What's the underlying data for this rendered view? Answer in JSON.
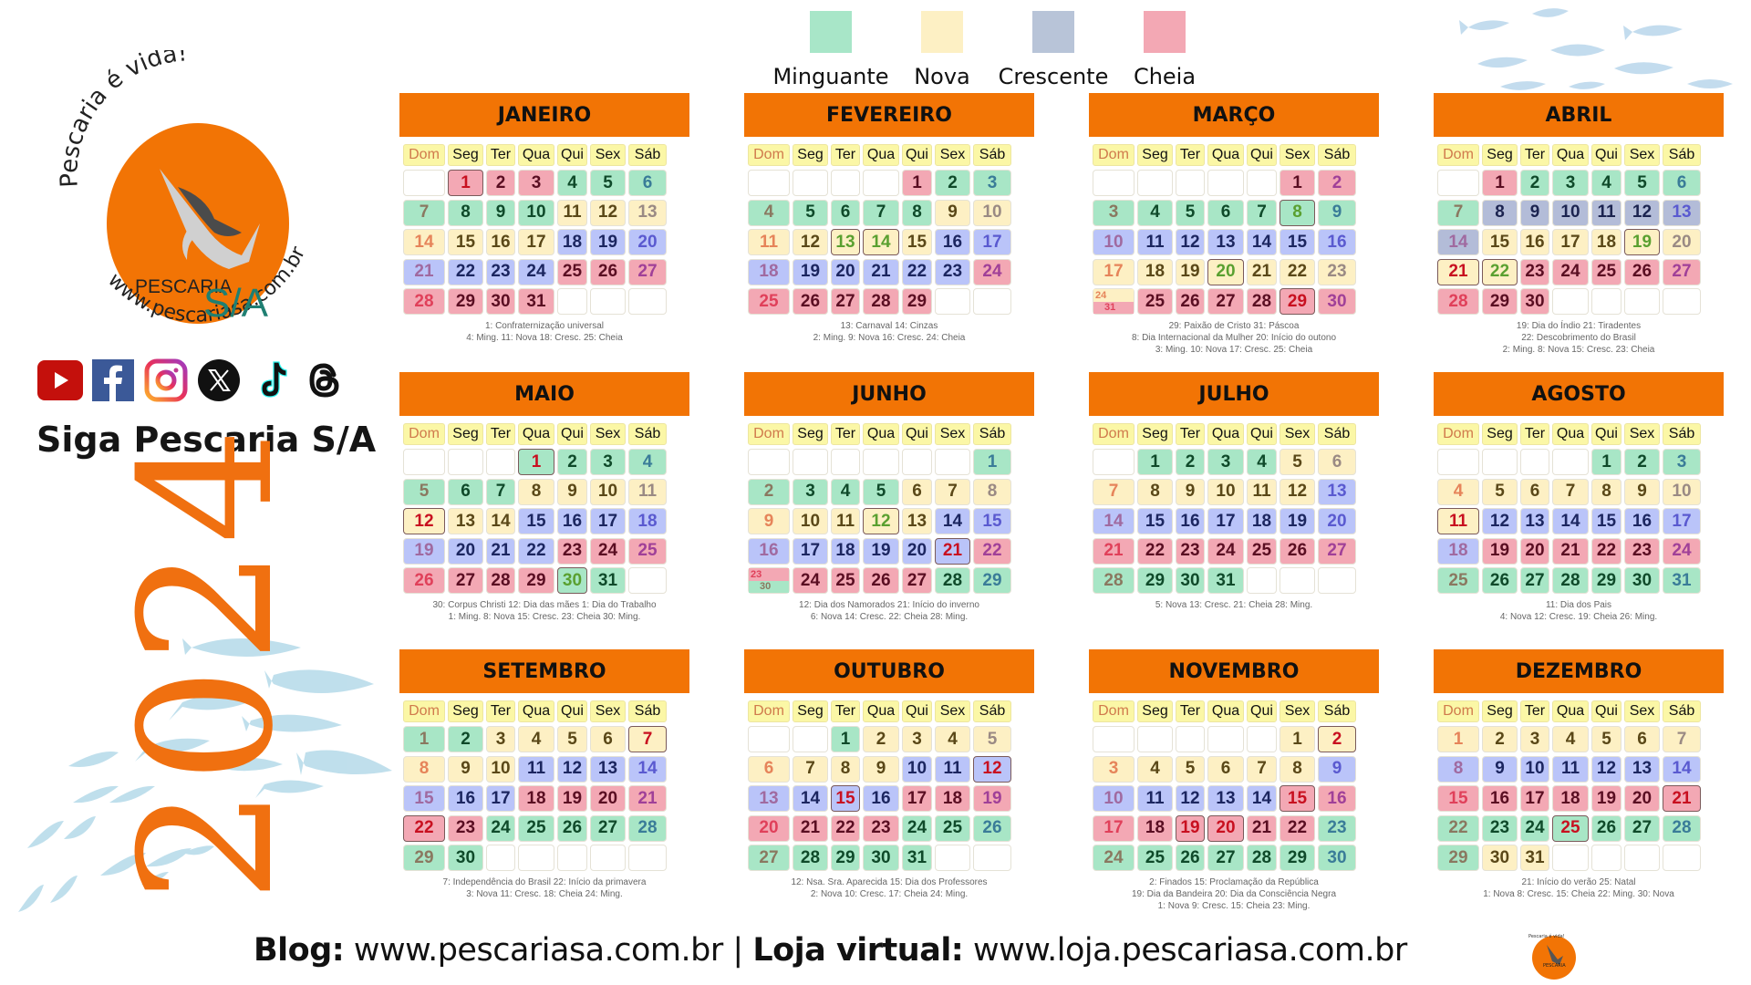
{
  "brand": {
    "tagline": "Pescaria é vida!",
    "name_main": "PESCARIA",
    "name_suffix": "S/A",
    "site": "www.pescariasa.com.br",
    "accent": "#f27405",
    "follow": "Siga Pescaria S/A",
    "year": "2024"
  },
  "socials": [
    {
      "name": "youtube",
      "icon": "youtube-icon"
    },
    {
      "name": "facebook",
      "icon": "facebook-icon"
    },
    {
      "name": "instagram",
      "icon": "instagram-icon"
    },
    {
      "name": "x",
      "icon": "x-icon"
    },
    {
      "name": "tiktok",
      "icon": "tiktok-icon"
    },
    {
      "name": "threads",
      "icon": "threads-icon"
    }
  ],
  "legend": [
    {
      "label": "Minguante",
      "color": "#a8e6c6"
    },
    {
      "label": "Nova",
      "color": "#fdf0c4"
    },
    {
      "label": "Crescente",
      "color": "#b8c4d8"
    },
    {
      "label": "Cheia",
      "color": "#f3a8b4"
    }
  ],
  "weekdays": [
    "Dom",
    "Seg",
    "Ter",
    "Qua",
    "Qui",
    "Sex",
    "Sáb"
  ],
  "months": [
    {
      "name": "JANEIRO",
      "cells": "w,p1h,p2,p3,g4,g5,g6|g7,g8,g9,g10,y11,y12,y13|y14,y15,y16,y17,b18,b19,b20|b21,b22,b23,b24,p25,p26,p27|p28,p29,p30,p31,w,w,w",
      "notes": [
        "1: Confraternização universal",
        "4: Ming.  11: Nova  18: Cresc.  25: Cheia"
      ]
    },
    {
      "name": "FEVEREIRO",
      "cells": "w,w,w,w,p1,g2,g3|g4,g5,g6,g7,g8,y9,y10|y11,y12,y13k,y14k,y15,b16,b17|b18,b19,b20,b21,b22,b23,p24|p25,p26,p27,p28,p29,w,w",
      "notes": [
        "13: Carnaval  14: Cinzas",
        "2: Ming.  9: Nova  16: Cresc.  24: Cheia"
      ]
    },
    {
      "name": "MARÇO",
      "cells": "w,w,w,w,w,p1,p2|g3,g4,g5,g6,g7,g8k,g9|b10,b11,b12,b13,b14,b15,b16|y17,y18,y19,y20k,y21,y22,y23|s24/31,p25,p26,p27,p28,p29h,p30",
      "notes": [
        "29: Paixão de Cristo  31: Páscoa",
        "8: Dia Internacional da Mulher  20: Início do outono",
        "3: Ming.  10: Nova  17: Cresc.  25: Cheia"
      ]
    },
    {
      "name": "ABRIL",
      "cells": "w,p1,g2,g3,g4,g5,g6|g7,a8,a9,a10,a11,a12,a13|a14,y15,y16,y17,y18,y19k,y20|y21h,y22k,p23,p24,p25,p26,p27|p28,p29,p30,w,w,w,w",
      "notes": [
        "19: Dia do Índio  21: Tiradentes",
        "22: Descobrimento do Brasil",
        "2: Ming.  8: Nova  15: Cresc.  23: Cheia"
      ]
    },
    {
      "name": "MAIO",
      "cells": "w,w,w,g1h,g2,g3,g4|g5,g6,g7,y8,y9,y10,y11|y12h,y13,y14,b15,b16,b17,b18|b19,b20,b21,b22,p23,p24,p25|p26,p27,p28,p29,g30k,g31,w",
      "notes": [
        "30: Corpus Christi  12: Dia das mães  1: Dia do Trabalho",
        "1: Ming.  8: Nova  15: Cresc.  23: Cheia  30: Ming."
      ]
    },
    {
      "name": "JUNHO",
      "cells": "w,w,w,w,w,w,g1|g2,g3,g4,g5,y6,y7,y8|y9,y10,y11,y12k,y13,b14,b15|b16,b17,b18,b19,b20,b21h,p22|t23/30,p24,p25,p26,p27,g28,g29",
      "notes": [
        "12: Dia dos Namorados  21: Início do inverno",
        "6: Nova  14: Cresc.  22: Cheia  28: Ming."
      ]
    },
    {
      "name": "JULHO",
      "cells": "w,g1,g2,g3,g4,y5,y6|y7,y8,y9,y10,y11,y12,b13|b14,b15,b16,b17,b18,b19,b20|p21,p22,p23,p24,p25,p26,p27|g28,g29,g30,g31,w,w,w",
      "notes": [
        "5: Nova  13: Cresc.  21: Cheia  28: Ming."
      ]
    },
    {
      "name": "AGOSTO",
      "cells": "w,w,w,w,g1,g2,g3|y4,y5,y6,y7,y8,y9,y10|y11h,b12,b13,b14,b15,b16,b17|b18,p19,p20,p21,p22,p23,p24|g25,g26,g27,g28,g29,g30,g31",
      "notes": [
        "11: Dia dos Pais",
        "4: Nova  12: Cresc.  19: Cheia  26: Ming."
      ]
    },
    {
      "name": "SETEMBRO",
      "cells": "g1,g2,y3,y4,y5,y6,y7h|y8,y9,y10,b11,b12,b13,b14|b15,b16,b17,p18,p19,p20,p21|p22h,p23,g24,g25,g26,g27,g28|g29,g30,w,w,w,w,w",
      "notes": [
        "7: Independência do Brasil  22: Início da primavera",
        "3: Nova  11: Cresc.  18: Cheia  24: Ming."
      ]
    },
    {
      "name": "OUTUBRO",
      "cells": "w,w,g1,y2,y3,y4,y5|y6,y7,y8,y9,b10,b11,b12h|b13,b14,b15h,b16,p17,p18,p19|p20,p21,p22,p23,g24,g25,g26|g27,g28,g29,g30,g31,w,w",
      "notes": [
        "12: Nsa. Sra. Aparecida  15: Dia dos Professores",
        "2: Nova  10: Cresc.  17: Cheia  24: Ming."
      ]
    },
    {
      "name": "NOVEMBRO",
      "cells": "w,w,w,w,w,y1,y2h|y3,y4,y5,y6,y7,y8,b9|b10,b11,b12,b13,b14,p15h,p16|p17,p18,p19h,p20h,p21,p22,g23|g24,g25,g26,g27,g28,g29,g30",
      "notes": [
        "2: Finados  15: Proclamação da República",
        "19: Dia da Bandeira  20: Dia da Consciência Negra",
        "1: Nova  9: Cresc.  15: Cheia  23: Ming."
      ]
    },
    {
      "name": "DEZEMBRO",
      "cells": "y1,y2,y3,y4,y5,y6,y7|b8,b9,b10,b11,b12,b13,b14|p15,p16,p17,p18,p19,p20,p21h|g22,g23,g24,g25h,g26,g27,g28|g29,y30,y31,w,w,w,w",
      "notes": [
        "21: Início do verão  25: Natal",
        "1: Nova  8: Cresc.  15: Cheia  22: Ming.  30: Nova"
      ]
    }
  ],
  "footer": {
    "blog_label": "Blog:",
    "blog_url": "www.pescariasa.com.br",
    "separator": "|",
    "store_label": "Loja virtual:",
    "store_url": "www.loja.pescariasa.com.br"
  }
}
